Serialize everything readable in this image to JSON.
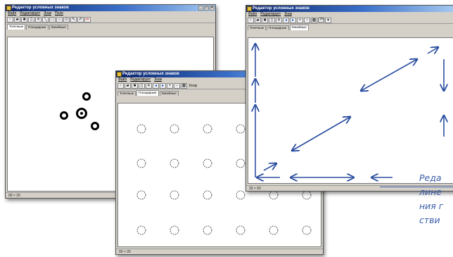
{
  "window1": {
    "title": "Редактор условных знаков",
    "menu": [
      "Файл",
      "Редактирует",
      "Знак",
      "Поле"
    ],
    "tabs": [
      "Точечные",
      "Площадные",
      "Линейные"
    ],
    "status": "00 × 20"
  },
  "window2": {
    "title": "Редактор условных знаков",
    "menu": [
      "Файл",
      "Редактирует",
      "Знак"
    ],
    "tabs": [
      "Точечные",
      "Площадные",
      "Линейные"
    ],
    "extra": "Коор",
    "status": "00 × 20"
  },
  "window3": {
    "title": "Редактор условных знаков",
    "menu": [
      "Файл",
      "Редактирует",
      "Знак"
    ],
    "tabs": [
      "Точечные",
      "Площадные",
      "Линейные"
    ],
    "field_value": "20",
    "status": "33 × 50"
  },
  "window_controls": {
    "minimize": "_",
    "maximize": "□",
    "close": "×"
  },
  "caption": {
    "lines": [
      "Реда",
      "лине",
      "ния г",
      "стви"
    ]
  },
  "colors": {
    "accent": "#2a4ea0",
    "caption": "#3a5ca8",
    "titlebar": "#0a246a"
  }
}
